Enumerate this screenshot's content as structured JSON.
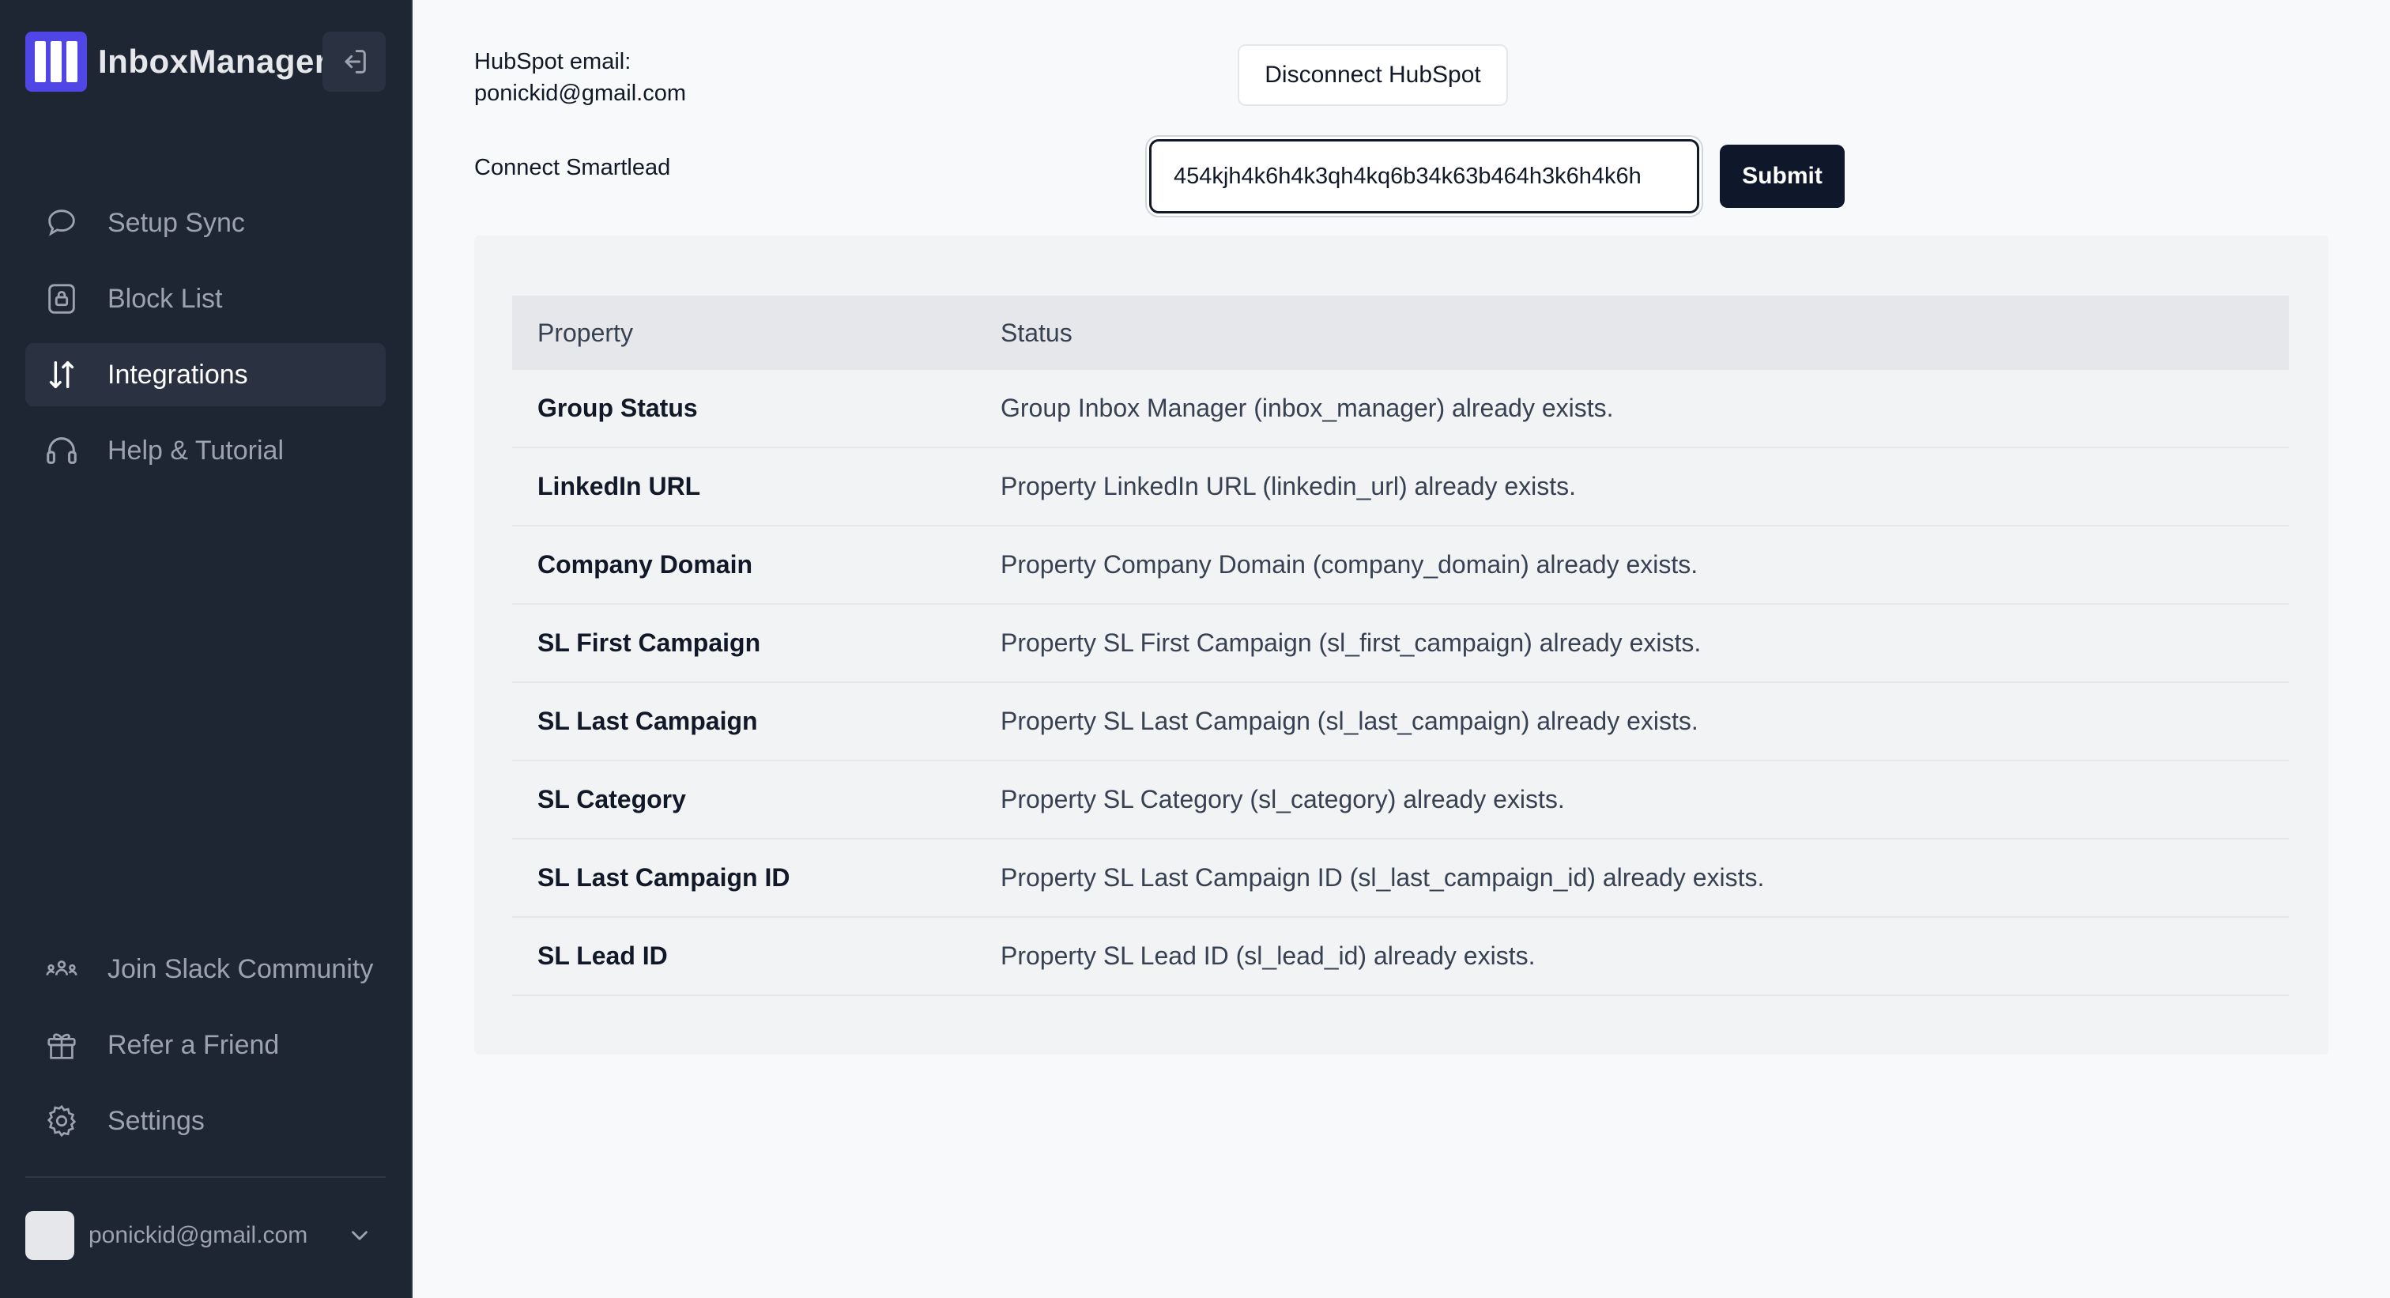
{
  "brand": {
    "name": "InboxManager"
  },
  "sidebar": {
    "nav": [
      {
        "label": "Setup Sync",
        "icon": "chat-bubble-icon",
        "active": false
      },
      {
        "label": "Block List",
        "icon": "lock-icon",
        "active": false
      },
      {
        "label": "Integrations",
        "icon": "arrows-up-down-icon",
        "active": true
      },
      {
        "label": "Help & Tutorial",
        "icon": "headset-icon",
        "active": false
      }
    ],
    "bottom": [
      {
        "label": "Join Slack Community",
        "icon": "community-icon"
      },
      {
        "label": "Refer a Friend",
        "icon": "gift-icon"
      },
      {
        "label": "Settings",
        "icon": "gear-icon"
      }
    ],
    "account_email": "ponickid@gmail.com"
  },
  "hubspot": {
    "label_line1": "HubSpot email:",
    "label_line2": "ponickid@gmail.com",
    "disconnect_label": "Disconnect HubSpot"
  },
  "smartlead": {
    "label": "Connect Smartlead",
    "input_value": "454kjh4k6h4k3qh4kq6b34k63b464h3k6h4k6h",
    "submit_label": "Submit"
  },
  "table": {
    "headers": [
      "Property",
      "Status"
    ],
    "rows": [
      {
        "property": "Group Status",
        "status": "Group Inbox Manager (inbox_manager) already exists."
      },
      {
        "property": "LinkedIn URL",
        "status": "Property LinkedIn URL (linkedin_url) already exists."
      },
      {
        "property": "Company Domain",
        "status": "Property Company Domain (company_domain) already exists."
      },
      {
        "property": "SL First Campaign",
        "status": "Property SL First Campaign (sl_first_campaign) already exists."
      },
      {
        "property": "SL Last Campaign",
        "status": "Property SL Last Campaign (sl_last_campaign) already exists."
      },
      {
        "property": "SL Category",
        "status": "Property SL Category (sl_category) already exists."
      },
      {
        "property": "SL Last Campaign ID",
        "status": "Property SL Last Campaign ID (sl_last_campaign_id) already exists."
      },
      {
        "property": "SL Lead ID",
        "status": "Property SL Lead ID (sl_lead_id) already exists."
      }
    ]
  },
  "colors": {
    "sidebar_bg": "#1e2533",
    "accent": "#4f46e5",
    "primary_button": "#0f172a"
  }
}
